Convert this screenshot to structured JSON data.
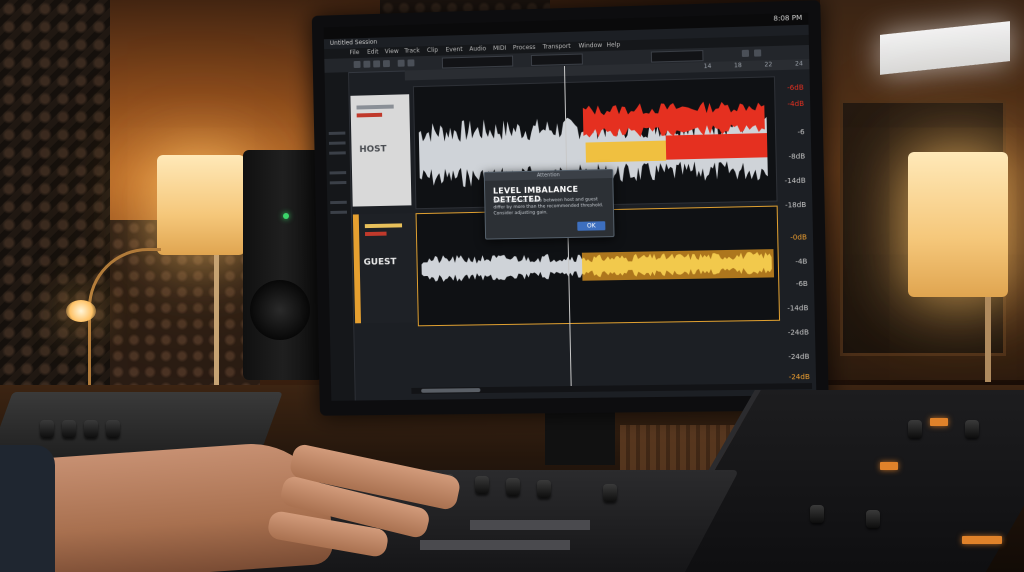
{
  "daw": {
    "app_title": "Untitled Session",
    "os_status": "8:08 PM",
    "menu": [
      "File",
      "Edit",
      "View",
      "Track",
      "Clip",
      "Event",
      "Audio",
      "MIDI",
      "Process",
      "Transport",
      "Window",
      "Help"
    ],
    "tracks": [
      {
        "label": "HOST"
      },
      {
        "label": "GUEST"
      }
    ],
    "db_scale": [
      "-6dB",
      "-4dB",
      "-6",
      "-8dB",
      "-14dB",
      "-18dB",
      "-0dB",
      "-4B",
      "-6B",
      "-14dB",
      "-24dB",
      "-24dB",
      "-24dB"
    ],
    "ruler": [
      "14",
      "18",
      "22",
      "24"
    ],
    "dialog": {
      "title": "Attention",
      "heading": "LEVEL IMBALANCE DETECTED",
      "body": "The vocal track levels between host and guest differ by more than the recommended threshold. Consider adjusting gain.",
      "ok_label": "OK"
    }
  },
  "colors": {
    "host_clip_loud": "#e53020",
    "host_clip_warn": "#f0a030",
    "guest_clip": "#e0a030",
    "waveform": "#cfd3d8",
    "dialog_button": "#3d6fbf"
  }
}
